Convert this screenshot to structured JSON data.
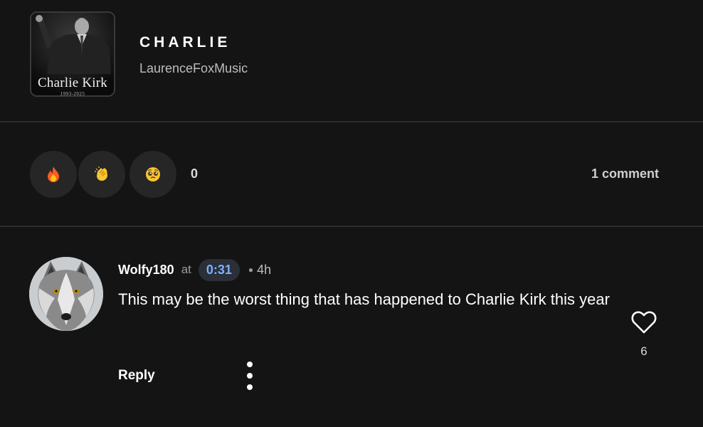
{
  "track": {
    "title": "CHARLIE",
    "artist": "LaurenceFoxMusic",
    "artwork": {
      "name": "Charlie Kirk",
      "years": "1993-2025"
    }
  },
  "reactions": {
    "icons": [
      "fire-icon",
      "clap-icon",
      "pleading-face-icon"
    ],
    "count": "0",
    "comments_label": "1 comment"
  },
  "comment": {
    "username": "Wolfy180",
    "at_label": "at",
    "timestamp": "0:31",
    "age": "4h",
    "text": "This may be the worst thing that has happened to Charlie Kirk this year",
    "like_count": "6",
    "reply_label": "Reply",
    "avatar": "wolf-avatar"
  },
  "colors": {
    "background": "#141414",
    "timestamp_text": "#7fb0ff",
    "timestamp_bg": "#2a2f38",
    "divider": "#2c2c2c"
  }
}
